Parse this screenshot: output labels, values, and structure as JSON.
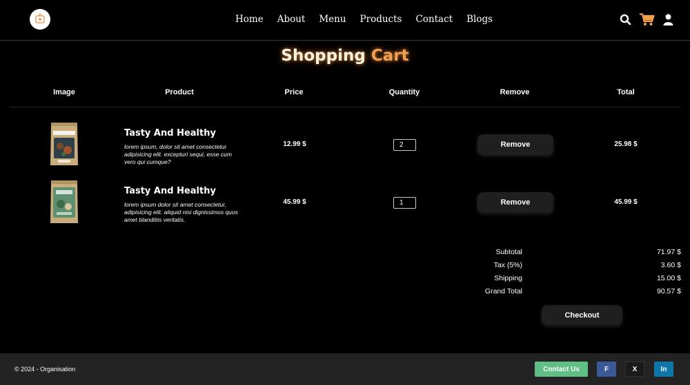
{
  "header": {
    "nav": [
      "Home",
      "About",
      "Menu",
      "Products",
      "Contact",
      "Blogs"
    ],
    "icons": [
      "search-icon",
      "cart-icon",
      "user-icon"
    ],
    "accent_color": "#f0a050"
  },
  "title": {
    "part1": "Shopping",
    "part2": "Cart"
  },
  "table": {
    "headers": [
      "Image",
      "Product",
      "Price",
      "Quantity",
      "Remove",
      "Total"
    ],
    "rows": [
      {
        "name": "Tasty And Healthy",
        "description": "lorem ipsum, dolor sit amet consectetur adipisicing elit. excepturi sequi, esse cum vero qui cumque?",
        "price": "12.99 $",
        "quantity": "2",
        "remove_label": "Remove",
        "total": "25.98 $"
      },
      {
        "name": "Tasty And Healthy",
        "description": "lorem ipsum dolor sit amet consectetur, adipisicing elit. aliquid nisi dignissimos quos amet blanditiis veritatis.",
        "price": "45.99 $",
        "quantity": "1",
        "remove_label": "Remove",
        "total": "45.99 $"
      }
    ]
  },
  "summary": {
    "subtotal_label": "Subtotal",
    "subtotal": "71.97 $",
    "tax_label": "Tax (5%)",
    "tax": "3.60 $",
    "shipping_label": "Shipping",
    "shipping": "15.00 $",
    "grand_total_label": "Grand Total",
    "grand_total": "90.57 $",
    "checkout_label": "Checkout"
  },
  "footer": {
    "copyright": "© 2024 - Organisation",
    "contact_label": "Contact Us",
    "facebook_label": "F",
    "x_label": "X",
    "linkedin_label": "In",
    "contact_color": "#5fbf85",
    "facebook_color": "#3b5998",
    "x_color": "#1a1a1a",
    "linkedin_color": "#0e76a8"
  }
}
